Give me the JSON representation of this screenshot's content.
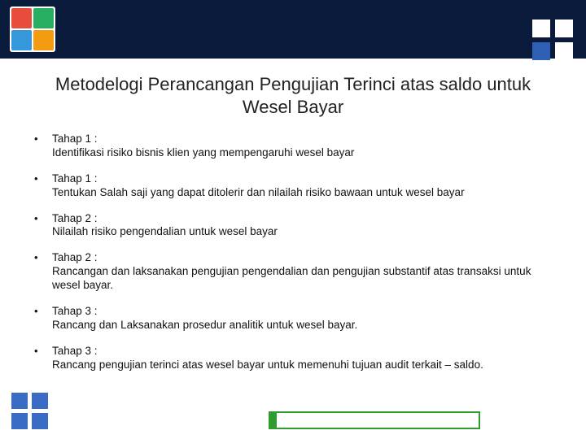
{
  "title": "Metodelogi Perancangan   Pengujian Terinci atas saldo untuk Wesel Bayar",
  "bullets": [
    {
      "stage": "Tahap 1 :",
      "text": "Identifikasi risiko bisnis klien yang mempengaruhi wesel bayar"
    },
    {
      "stage": "Tahap 1 :",
      "text": "Tentukan Salah saji yang dapat ditolerir dan nilailah risiko bawaan untuk wesel bayar"
    },
    {
      "stage": "Tahap 2 :",
      "text": "Nilailah risiko pengendalian untuk wesel bayar"
    },
    {
      "stage": "Tahap 2 :",
      "text": "Rancangan dan laksanakan pengujian pengendalian dan pengujian substantif atas transaksi untuk wesel bayar."
    },
    {
      "stage": "Tahap 3 :",
      "text": "Rancang dan Laksanakan prosedur analitik untuk wesel bayar."
    },
    {
      "stage": "Tahap 3 :",
      "text": "Rancang pengujian terinci atas wesel bayar untuk memenuhi tujuan audit terkait – saldo."
    }
  ]
}
